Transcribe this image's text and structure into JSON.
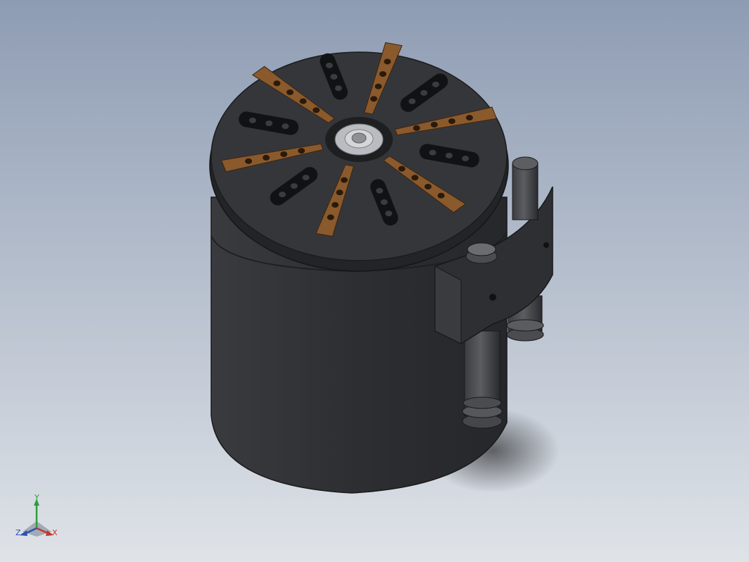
{
  "viewport": {
    "background_top": "#8e9cb3",
    "background_bottom": "#dfe3e8"
  },
  "model": {
    "body_color": "#2f3033",
    "jaw_color": "#8a5a2c",
    "slot_color": "#111214",
    "hub_color": "#b9bcc0"
  },
  "triad": {
    "x_label": "X",
    "y_label": "Y",
    "z_label": "Z",
    "x_color": "#c0392b",
    "y_color": "#2e9e3a",
    "z_color": "#2c4fb0"
  }
}
